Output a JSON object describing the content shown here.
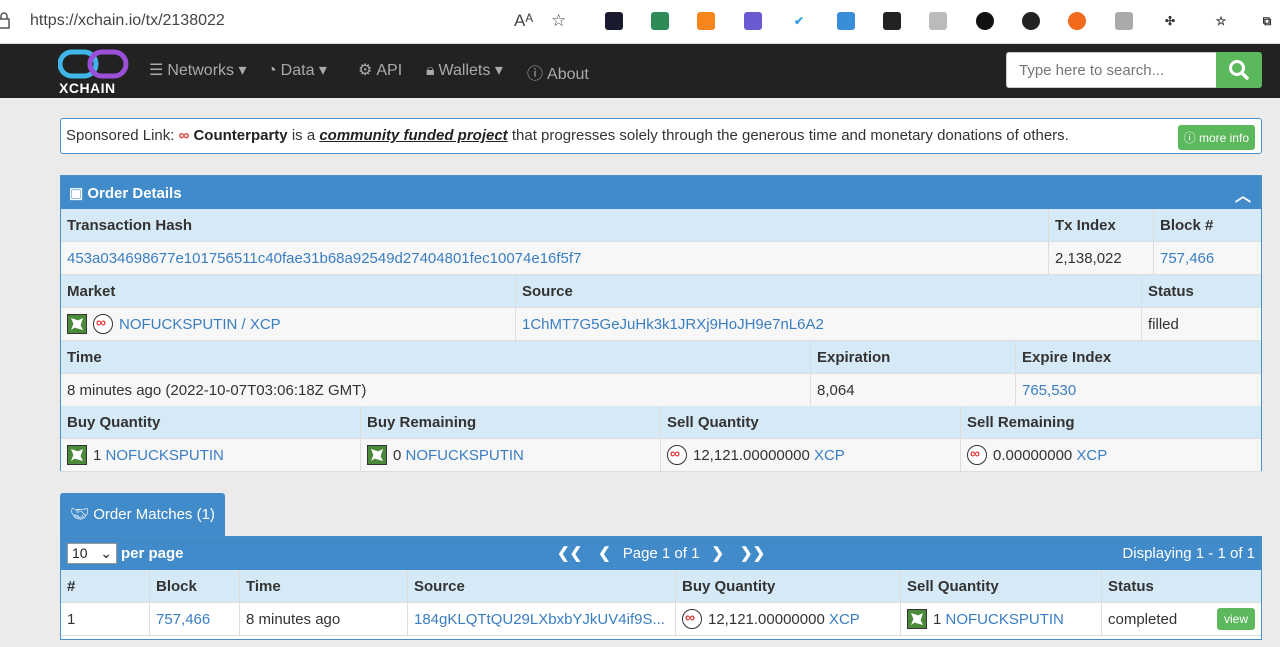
{
  "browser": {
    "url": "https://xchain.io/tx/2138022",
    "read_aloud": "Aᴬ",
    "fav": "☆"
  },
  "nav": {
    "logo_text": "XCHAIN",
    "items": [
      {
        "label": "Networks",
        "icon": "database-icon",
        "caret": true
      },
      {
        "label": "Data",
        "icon": "dashboard-icon",
        "caret": true
      },
      {
        "label": "API",
        "icon": "cogs-icon",
        "caret": false
      },
      {
        "label": "Wallets",
        "icon": "lock-icon",
        "caret": true
      },
      {
        "label": "About",
        "icon": "info-icon",
        "caret": false
      }
    ],
    "search_placeholder": "Type here to search..."
  },
  "sponsor": {
    "prefix": "Sponsored Link:",
    "name": "Counterparty",
    "is_a": "is a",
    "project": "community funded project",
    "rest": "that progresses solely through the generous time and monetary donations of others.",
    "more_info": "more info"
  },
  "order": {
    "title": "Order Details",
    "tx_hash_label": "Transaction Hash",
    "tx_index_label": "Tx Index",
    "block_label": "Block #",
    "tx_hash": "453a034698677e101756511c40fae31b68a92549d27404801fec10074e16f5f7",
    "tx_index": "2,138,022",
    "block": "757,466",
    "market_label": "Market",
    "source_label": "Source",
    "status_label": "Status",
    "market": "NOFUCKSPUTIN / XCP",
    "source": "1ChMT7G5GeJuHk3k1JRXj9HoJH9e7nL6A2",
    "status": "filled",
    "time_label": "Time",
    "expiration_label": "Expiration",
    "expire_index_label": "Expire Index",
    "time": "8 minutes ago (2022-10-07T03:06:18Z GMT)",
    "expiration": "8,064",
    "expire_index": "765,530",
    "buy_qty_label": "Buy Quantity",
    "buy_rem_label": "Buy Remaining",
    "sell_qty_label": "Sell Quantity",
    "sell_rem_label": "Sell Remaining",
    "buy_qty_num": "1",
    "buy_qty_asset": "NOFUCKSPUTIN",
    "buy_rem_num": "0",
    "buy_rem_asset": "NOFUCKSPUTIN",
    "sell_qty_num": "12,121.00000000",
    "sell_qty_asset": "XCP",
    "sell_rem_num": "0.00000000",
    "sell_rem_asset": "XCP"
  },
  "matches": {
    "tab_label": "Order Matches (1)",
    "per_page_value": "10",
    "per_page_label": "per page",
    "page_text": "Page 1 of 1",
    "displaying": "Displaying 1 - 1 of 1",
    "columns": [
      "#",
      "Block",
      "Time",
      "Source",
      "Buy Quantity",
      "Sell Quantity",
      "Status"
    ],
    "row": {
      "num": "1",
      "block": "757,466",
      "time": "8 minutes ago",
      "source": "184gKLQTtQU29LXbxbYJkUV4if9S...",
      "buy_num": "12,121.00000000",
      "buy_asset": "XCP",
      "sell_num": "1",
      "sell_asset": "NOFUCKSPUTIN",
      "status": "completed",
      "view": "view"
    }
  }
}
